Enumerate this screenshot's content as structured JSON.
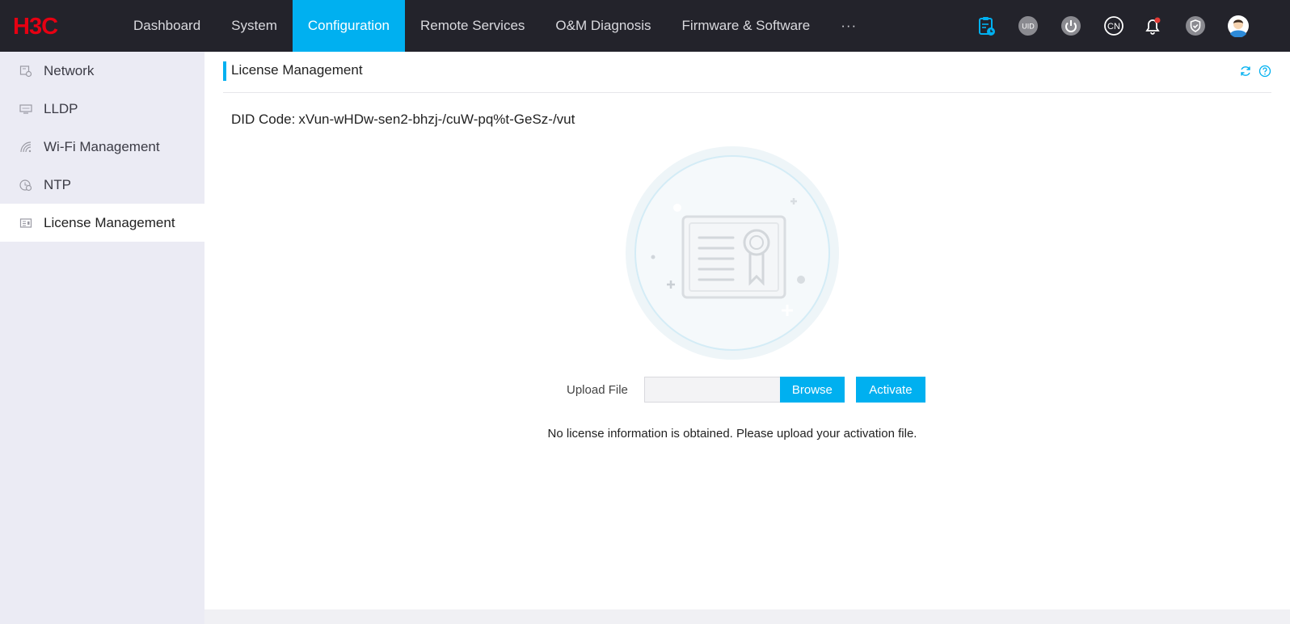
{
  "brand": {
    "logo_text": "H3C",
    "logo_color": "#e60012"
  },
  "nav": {
    "items": [
      {
        "label": "Dashboard",
        "active": false
      },
      {
        "label": "System",
        "active": false
      },
      {
        "label": "Configuration",
        "active": true
      },
      {
        "label": "Remote Services",
        "active": false
      },
      {
        "label": "O&M Diagnosis",
        "active": false
      },
      {
        "label": "Firmware & Software",
        "active": false
      }
    ],
    "more_label": "···"
  },
  "top_icons": {
    "task": "clipboard-clock-icon",
    "uid_label": "UID",
    "power": "power-icon",
    "language_label": "CN",
    "notifications": "bell-icon",
    "security": "shield-check-icon",
    "user": "user-avatar-icon"
  },
  "sidebar": {
    "items": [
      {
        "label": "Network",
        "icon": "network-icon",
        "active": false
      },
      {
        "label": "LLDP",
        "icon": "lldp-icon",
        "active": false
      },
      {
        "label": "Wi-Fi Management",
        "icon": "wifi-icon",
        "active": false
      },
      {
        "label": "NTP",
        "icon": "ntp-clock-icon",
        "active": false
      },
      {
        "label": "License Management",
        "icon": "license-icon",
        "active": true
      }
    ]
  },
  "page": {
    "title": "License Management",
    "did_label": "DID Code:",
    "did_value": "xVun-wHDw-sen2-bhzj-/cuW-pq%t-GeSz-/vut",
    "upload_label": "Upload File",
    "upload_value": "",
    "browse_label": "Browse",
    "activate_label": "Activate",
    "message": "No license information is obtained. Please upload your activation file."
  },
  "colors": {
    "accent": "#00b0f0",
    "topbar": "#23232b",
    "sidebar": "#ebebf4",
    "alert": "#e53935"
  }
}
